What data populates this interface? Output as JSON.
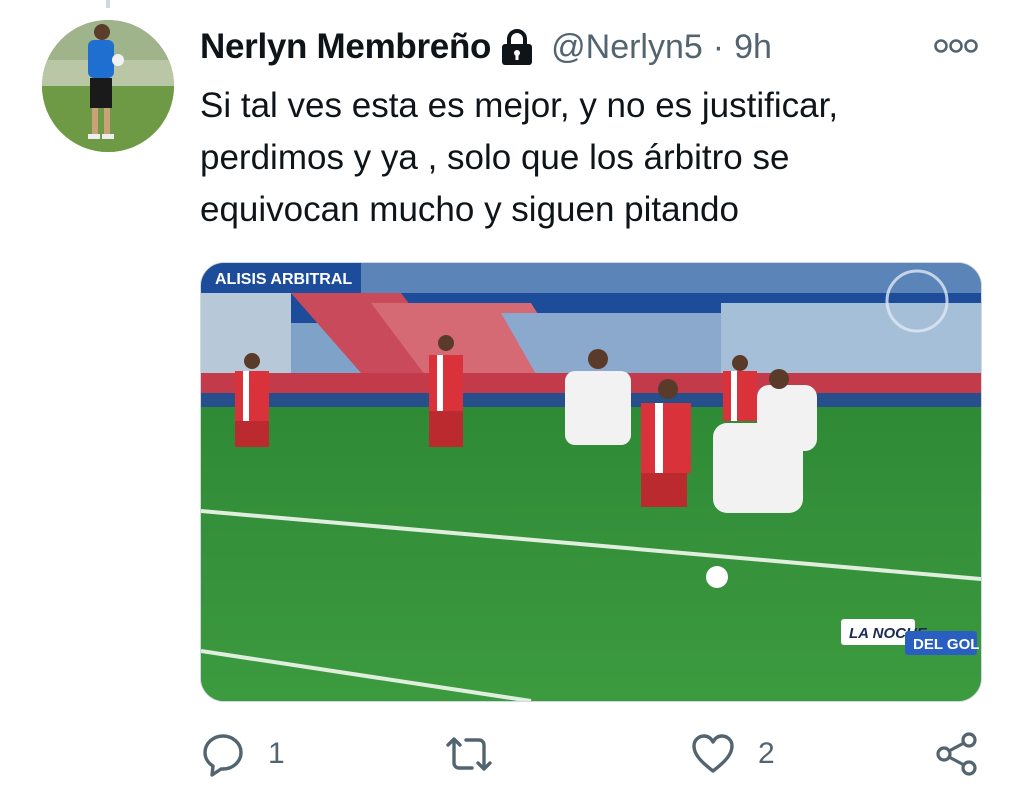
{
  "tweet": {
    "display_name": "Nerlyn Membreño",
    "handle": "@Nerlyn5",
    "separator": "·",
    "time": "9h",
    "text_lines": [
      "Si tal ves esta es mejor, y no es justificar,",
      "perdimos y ya , solo que los árbitro se",
      "equivocan mucho y siguen pitando"
    ],
    "media": {
      "overlay_top_left": "ALISIS ARBITRAL",
      "broadcaster_line1": "LA NOCHE",
      "broadcaster_line2": "DEL GOL"
    },
    "actions": {
      "reply_count": "1",
      "retweet_count": "",
      "like_count": "2"
    }
  },
  "colors": {
    "text_primary": "#0f1419",
    "text_secondary": "#536471",
    "icon": "#536471"
  }
}
